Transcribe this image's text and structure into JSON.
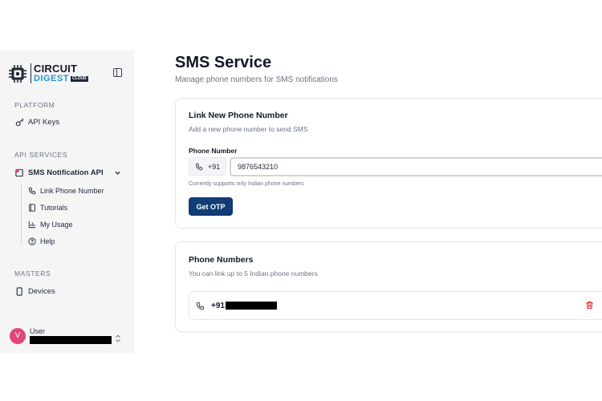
{
  "sidebar": {
    "logo": {
      "line1": "CIRCUIT",
      "line2": "DIGEST",
      "badge": "CLOUD"
    },
    "sections": {
      "platform": "PLATFORM",
      "api_services": "API SERVICES",
      "masters": "MASTERS"
    },
    "items": {
      "api_keys": "API Keys",
      "sms_api": "SMS Notification API",
      "link_phone": "Link Phone Number",
      "tutorials": "Tutorials",
      "my_usage": "My Usage",
      "help": "Help",
      "devices": "Devices"
    },
    "user": {
      "initial": "V",
      "name": "User"
    }
  },
  "main": {
    "title": "SMS Service",
    "subtitle": "Manage phone numbers for SMS notifications",
    "link_card": {
      "title": "Link New Phone Number",
      "description": "Add a new phone number to send SMS",
      "field_label": "Phone Number",
      "country_code": "+91",
      "phone_value": "9876543210",
      "hint": "Currently supports only Indian phone numbers",
      "button": "Get OTP"
    },
    "numbers_card": {
      "title": "Phone Numbers",
      "description": "You can link up to 5 Indian phone numbers",
      "entries": [
        {
          "prefix": "+91"
        }
      ]
    }
  },
  "colors": {
    "primary_button": "#0f3d74",
    "delete_icon": "#dc2626",
    "avatar": "#e0457b",
    "logo_accent": "#2596d1"
  }
}
